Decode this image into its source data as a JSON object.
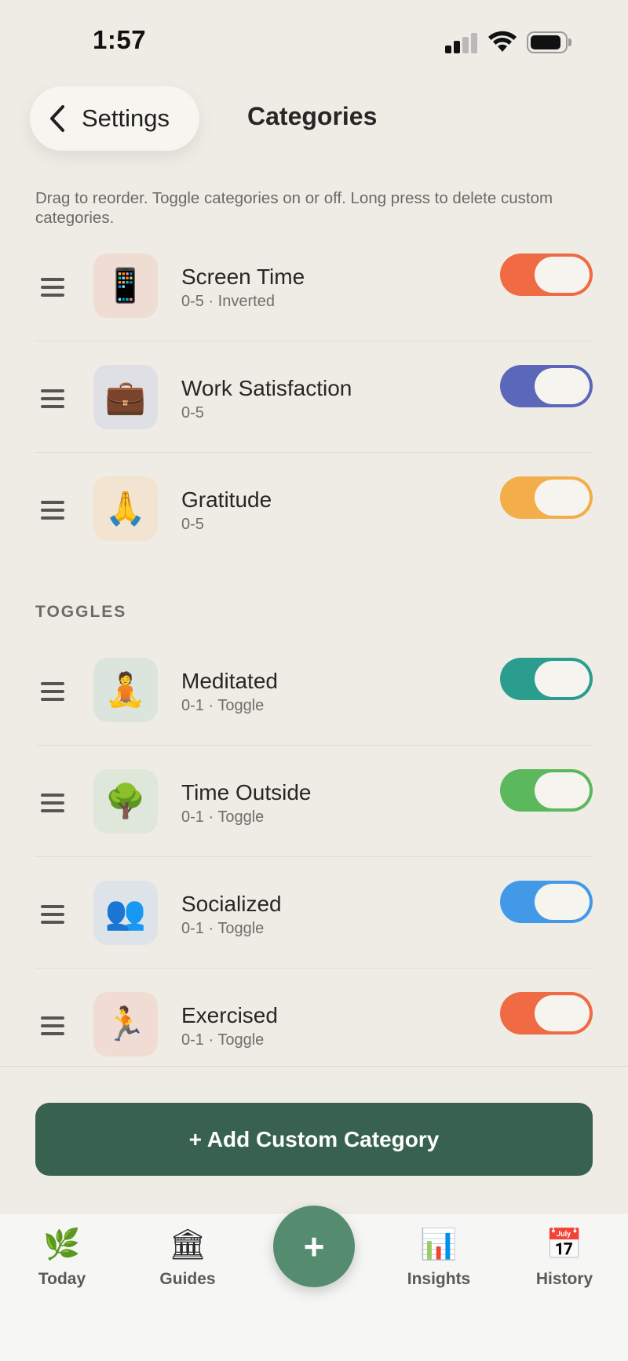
{
  "status": {
    "time": "1:57"
  },
  "header": {
    "back_label": "Settings",
    "title": "Categories"
  },
  "hint": "Drag to reorder. Toggle categories on or off. Long press to delete custom categories.",
  "sections": [
    {
      "header": "",
      "items": [
        {
          "name": "Screen Time",
          "sub": "0-5 · Inverted",
          "emoji": "📱",
          "tile_color": "#efdcd2",
          "toggle_color": "#f06a43",
          "enabled": true
        },
        {
          "name": "Work Satisfaction",
          "sub": "0-5",
          "emoji": "💼",
          "tile_color": "#dfdfe6",
          "toggle_color": "#5b67b8",
          "enabled": true
        },
        {
          "name": "Gratitude",
          "sub": "0-5",
          "emoji": "🙏",
          "tile_color": "#f2e4d0",
          "toggle_color": "#f3ae4a",
          "enabled": true
        }
      ]
    },
    {
      "header": "TOGGLES",
      "items": [
        {
          "name": "Meditated",
          "sub": "0-1 · Toggle",
          "emoji": "🧘",
          "tile_color": "#dbe5dd",
          "toggle_color": "#2a9d8f",
          "enabled": true
        },
        {
          "name": "Time Outside",
          "sub": "0-1 · Toggle",
          "emoji": "🌳",
          "tile_color": "#dee7d9",
          "toggle_color": "#5cb85c",
          "enabled": true
        },
        {
          "name": "Socialized",
          "sub": "0-1 · Toggle",
          "emoji": "👥",
          "tile_color": "#dee3e9",
          "toggle_color": "#4299e8",
          "enabled": true
        },
        {
          "name": "Exercised",
          "sub": "0-1 · Toggle",
          "emoji": "🏃",
          "tile_color": "#f0dcd2",
          "toggle_color": "#f06a43",
          "enabled": true
        }
      ]
    }
  ],
  "add_button": "+ Add Custom Category",
  "tabs": [
    {
      "label": "Today",
      "icon": "🌿",
      "icon_name": "leaf-icon"
    },
    {
      "label": "Guides",
      "icon": "🏛",
      "icon_name": "classical-building-icon"
    },
    {
      "label": "Insights",
      "icon": "📊",
      "icon_name": "bar-chart-icon"
    },
    {
      "label": "History",
      "icon": "📅",
      "icon_name": "calendar-icon"
    }
  ],
  "fab": {
    "label": "+",
    "color": "#558b6e"
  }
}
